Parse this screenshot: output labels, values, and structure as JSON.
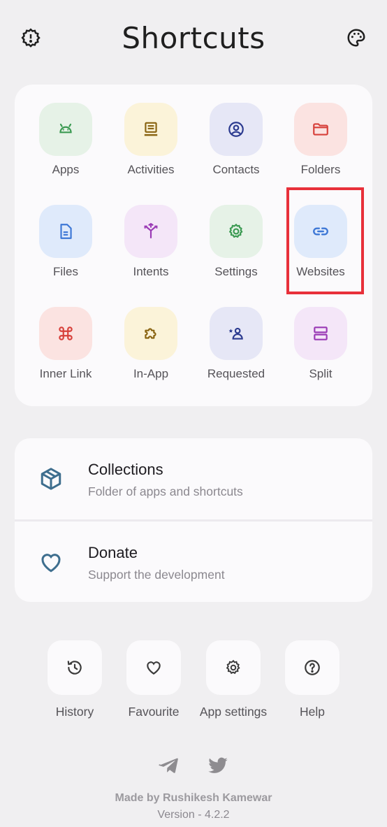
{
  "header": {
    "title": "Shortcuts",
    "left_icon": "alert-gear-icon",
    "right_icon": "palette-icon"
  },
  "grid": {
    "tiles": [
      {
        "label": "Apps",
        "icon": "android-icon",
        "bg": "#e6f2e7",
        "fg": "#3b9a52"
      },
      {
        "label": "Activities",
        "icon": "activity-icon",
        "bg": "#fbf3d9",
        "fg": "#8a6412"
      },
      {
        "label": "Contacts",
        "icon": "contact-icon",
        "bg": "#e6e7f6",
        "fg": "#2b3a8f"
      },
      {
        "label": "Folders",
        "icon": "folder-icon",
        "bg": "#fbe3e1",
        "fg": "#d7403a"
      },
      {
        "label": "Files",
        "icon": "file-icon",
        "bg": "#dfeafb",
        "fg": "#3e78d6"
      },
      {
        "label": "Intents",
        "icon": "intent-icon",
        "bg": "#f4e6f8",
        "fg": "#9a3ab5"
      },
      {
        "label": "Settings",
        "icon": "gear-icon",
        "bg": "#e6f2e7",
        "fg": "#3b9a52"
      },
      {
        "label": "Websites",
        "icon": "link-icon",
        "bg": "#dfeafb",
        "fg": "#3e78d6"
      },
      {
        "label": "Inner Link",
        "icon": "command-icon",
        "bg": "#fbe3e1",
        "fg": "#d7403a"
      },
      {
        "label": "In-App",
        "icon": "puzzle-icon",
        "bg": "#fbf3d9",
        "fg": "#8a6412"
      },
      {
        "label": "Requested",
        "icon": "person-star-icon",
        "bg": "#e6e7f6",
        "fg": "#2b3a8f"
      },
      {
        "label": "Split",
        "icon": "split-icon",
        "bg": "#f4e6f8",
        "fg": "#9a3ab5"
      }
    ]
  },
  "list": {
    "collections": {
      "title": "Collections",
      "subtitle": "Folder of apps and shortcuts",
      "icon": "cube-icon"
    },
    "donate": {
      "title": "Donate",
      "subtitle": "Support the development",
      "icon": "heart-icon"
    },
    "accent": "#3e6e8e"
  },
  "bottom": {
    "history": "History",
    "favourite": "Favourite",
    "app_settings": "App settings",
    "help": "Help"
  },
  "footer": {
    "credit": "Made by Rushikesh Kamewar",
    "version": "Version - 4.2.2",
    "social_icons": [
      "telegram-icon",
      "twitter-icon"
    ]
  }
}
